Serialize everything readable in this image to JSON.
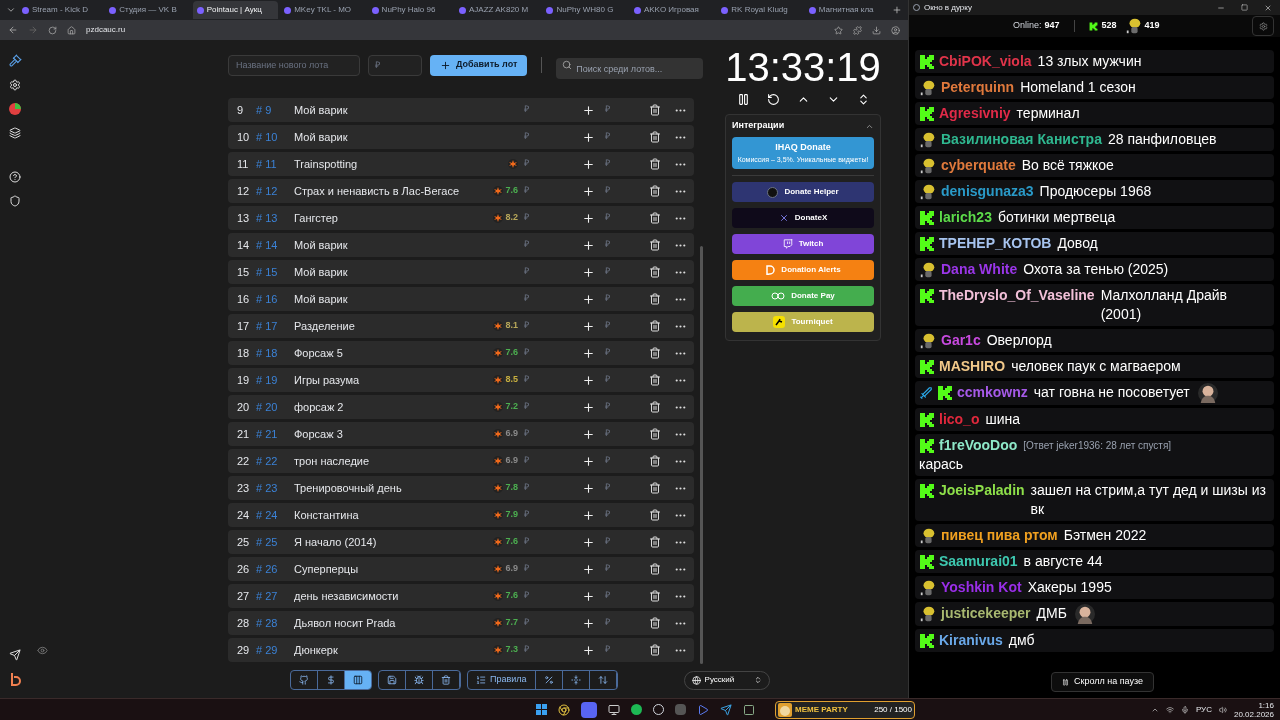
{
  "browser": {
    "tabs": [
      {
        "title": "Stream - Kick D",
        "selected": false
      },
      {
        "title": "Студия — VK В",
        "selected": false
      },
      {
        "title": "Pointauc | Аукц",
        "selected": true
      },
      {
        "title": "MKey TKL - MO",
        "selected": false
      },
      {
        "title": "NuPhy Halo 96",
        "selected": false
      },
      {
        "title": "AJAZZ AK820 M",
        "selected": false
      },
      {
        "title": "NuPhy WH80 G",
        "selected": false
      },
      {
        "title": "AKKO Игровая",
        "selected": false
      },
      {
        "title": "RK Royal Kludg",
        "selected": false
      },
      {
        "title": "Магнитная кла",
        "selected": false
      }
    ],
    "address": "pzdcauc.ru"
  },
  "toolbar": {
    "lot_name": {
      "placeholder": "Название нового лота"
    },
    "amount": {
      "placeholder": "₽"
    },
    "add_button": "Добавить лот",
    "search": {
      "placeholder": "Поиск среди лотов..."
    }
  },
  "lots": [
    {
      "index": "9",
      "id": "# 9",
      "name": "Мой варик",
      "badge": false,
      "currency": "₽",
      "currency2": "₽"
    },
    {
      "index": "10",
      "id": "# 10",
      "name": "Мой варик",
      "badge": false,
      "currency": "₽",
      "currency2": "₽"
    },
    {
      "index": "11",
      "id": "# 11",
      "name": "Trainspotting",
      "badge": true,
      "currency": "₽",
      "currency2": "₽"
    },
    {
      "index": "12",
      "id": "# 12",
      "name": "Страх и ненависть в Лас-Вегасе",
      "badge": true,
      "rating": "7.6",
      "color": "#4caf50",
      "currency": "₽",
      "currency2": "₽"
    },
    {
      "index": "13",
      "id": "# 13",
      "name": "Гангстер",
      "badge": true,
      "rating": "8.2",
      "color": "#b8a85a",
      "currency": "₽",
      "currency2": "₽"
    },
    {
      "index": "14",
      "id": "# 14",
      "name": "Мой варик",
      "badge": false,
      "currency": "₽",
      "currency2": "₽"
    },
    {
      "index": "15",
      "id": "# 15",
      "name": "Мой варик",
      "badge": false,
      "currency": "₽",
      "currency2": "₽"
    },
    {
      "index": "16",
      "id": "# 16",
      "name": "Мой варик",
      "badge": false,
      "currency": "₽",
      "currency2": "₽"
    },
    {
      "index": "17",
      "id": "# 17",
      "name": "Разделение",
      "badge": true,
      "rating": "8.1",
      "color": "#b8a85a",
      "currency": "₽",
      "currency2": "₽"
    },
    {
      "index": "18",
      "id": "# 18",
      "name": "Форсаж 5",
      "badge": true,
      "rating": "7.6",
      "color": "#4caf50",
      "currency": "₽",
      "currency2": "₽"
    },
    {
      "index": "19",
      "id": "# 19",
      "name": "Игры разума",
      "badge": true,
      "rating": "8.5",
      "color": "#c8b040",
      "currency": "₽",
      "currency2": "₽"
    },
    {
      "index": "20",
      "id": "# 20",
      "name": "форсаж 2",
      "badge": true,
      "rating": "7.2",
      "color": "#4caf50",
      "currency": "₽",
      "currency2": "₽"
    },
    {
      "index": "21",
      "id": "# 21",
      "name": "Форсаж 3",
      "badge": true,
      "rating": "6.9",
      "color": "#8a8a8a",
      "currency": "₽",
      "currency2": "₽"
    },
    {
      "index": "22",
      "id": "# 22",
      "name": "трон наследие",
      "badge": true,
      "rating": "6.9",
      "color": "#8a8a8a",
      "currency": "₽",
      "currency2": "₽"
    },
    {
      "index": "23",
      "id": "# 23",
      "name": "Тренировочный день",
      "badge": true,
      "rating": "7.8",
      "color": "#4caf50",
      "currency": "₽",
      "currency2": "₽"
    },
    {
      "index": "24",
      "id": "# 24",
      "name": "Константина",
      "badge": true,
      "rating": "7.9",
      "color": "#4caf50",
      "currency": "₽",
      "currency2": "₽"
    },
    {
      "index": "25",
      "id": "# 25",
      "name": "Я начало (2014)",
      "badge": true,
      "rating": "7.6",
      "color": "#4caf50",
      "currency": "₽",
      "currency2": "₽"
    },
    {
      "index": "26",
      "id": "# 26",
      "name": "Суперперцы",
      "badge": true,
      "rating": "6.9",
      "color": "#8a8a8a",
      "currency": "₽",
      "currency2": "₽"
    },
    {
      "index": "27",
      "id": "# 27",
      "name": "день независимости",
      "badge": true,
      "rating": "7.6",
      "color": "#4caf50",
      "currency": "₽",
      "currency2": "₽"
    },
    {
      "index": "28",
      "id": "# 28",
      "name": "Дьявол носит Prada",
      "badge": true,
      "rating": "7.7",
      "color": "#4caf50",
      "currency": "₽",
      "currency2": "₽"
    },
    {
      "index": "29",
      "id": "# 29",
      "name": "Дюнкерк",
      "badge": true,
      "rating": "7.3",
      "color": "#4caf50",
      "currency": "₽",
      "currency2": "₽"
    }
  ],
  "timer": {
    "time": "13:33:19"
  },
  "integrations": {
    "title": "Интеграции",
    "featured": {
      "name": "IHAQ Donate",
      "subtitle": "Комиссия – 3,5%. Уникальные виджеты!",
      "color": "#3396d3"
    },
    "buttons": [
      {
        "label": "Donate Helper",
        "color": "#2e3572"
      },
      {
        "label": "DonateX",
        "color": "#0f0a1a"
      },
      {
        "label": "Twitch",
        "color": "#8045d8"
      },
      {
        "label": "Donation Alerts",
        "color": "#f58112"
      },
      {
        "label": "Donate Pay",
        "color": "#44ad4e"
      },
      {
        "label": "Tourniquet",
        "color": "#bcb44c"
      }
    ]
  },
  "bottom_tools": [
    [
      {
        "selected": false
      },
      {
        "selected": false
      },
      {
        "selected": true
      }
    ],
    [
      {
        "selected": false
      },
      {
        "selected": false
      },
      {
        "selected": false
      }
    ],
    [
      {
        "label": "Правила",
        "selected": false
      },
      {
        "selected": false
      },
      {
        "selected": false
      },
      {
        "selected": false
      }
    ]
  ],
  "language": "Русский",
  "chat": {
    "title": "Окно в дурку",
    "online_label": "Online:",
    "online": "947",
    "kick_count": "528",
    "other_count": "419",
    "messages": [
      {
        "kind": "kick",
        "user": "CbiPOK_viola",
        "color": "#e0344a",
        "text": "13 злых мужчин",
        "emote": false,
        "mod": false
      },
      {
        "kind": "avatar",
        "user": "Peterquinn",
        "color": "#e0793c",
        "text": "Homeland 1 сезон",
        "emote": false,
        "mod": false
      },
      {
        "kind": "kick",
        "user": "Agresivniy",
        "color": "#e02a48",
        "text": "терминал",
        "emote": false,
        "mod": false
      },
      {
        "kind": "avatar",
        "user": "Вазилиновая Канистра",
        "color": "#2fb890",
        "text": "28 панфиловцев",
        "emote": false,
        "mod": false
      },
      {
        "kind": "avatar",
        "user": "cyberquate",
        "color": "#e07a3c",
        "text": "Во всё тяжкое",
        "emote": false,
        "mod": false
      },
      {
        "kind": "avatar",
        "user": "denisgunaza3",
        "color": "#2a9ac8",
        "text": "Продюсеры 1968",
        "emote": false,
        "mod": false
      },
      {
        "kind": "kick",
        "user": "larich23",
        "color": "#5ddc4a",
        "text": "ботинки мертвеца",
        "emote": false,
        "mod": false
      },
      {
        "kind": "kick",
        "user": "ТРЕНЕР_КОТОВ",
        "color": "#a7c4ef",
        "text": "Довод",
        "emote": false,
        "mod": false
      },
      {
        "kind": "avatar",
        "user": "Dana White",
        "color": "#9a36e8",
        "text": "Охота за тенью (2025)",
        "emote": false,
        "mod": false
      },
      {
        "kind": "kick",
        "user": "TheDryslo_Of_Vaseline",
        "color": "#f2c0d8",
        "text": "Малхолланд Драйв (2001)",
        "emote": false,
        "mod": false
      },
      {
        "kind": "avatar",
        "user": "Gar1c",
        "color": "#c84ae0",
        "text": "Оверлорд",
        "emote": false,
        "mod": false
      },
      {
        "kind": "kick",
        "user": "MASHIRO",
        "color": "#f2c98a",
        "text": "человек паук с магваером",
        "emote": false,
        "mod": false
      },
      {
        "kind": "kick",
        "user": "ccmkownz",
        "color": "#a65ae8",
        "text": "чат говна не посоветует",
        "emote": true,
        "mod": true
      },
      {
        "kind": "kick",
        "user": "lico_o",
        "color": "#e0283c",
        "text": "шина",
        "emote": false,
        "mod": false
      },
      {
        "kind": "kick",
        "user": "f1reVooDoo",
        "color": "#8ee8c8",
        "reply": "[Ответ jeker1936: 28 лет спустя]",
        "text": "карась",
        "emote": false,
        "mod": false
      },
      {
        "kind": "kick",
        "user": "JoeisPaladin",
        "color": "#8ee04a",
        "text": "зашел на стрим,а тут дед и шизы из вк",
        "emote": false,
        "mod": false
      },
      {
        "kind": "avatar",
        "user": "пивец пива ртом",
        "color": "#f0a020",
        "text": "Бэтмен 2022",
        "emote": false,
        "mod": false
      },
      {
        "kind": "kick",
        "user": "Saamurai01",
        "color": "#3ec8b0",
        "text": "в августе 44",
        "emote": false,
        "mod": false
      },
      {
        "kind": "avatar",
        "user": "Yoshkin Kot",
        "color": "#9a2ee8",
        "text": "Хакеры 1995",
        "emote": false,
        "mod": false
      },
      {
        "kind": "avatar",
        "user": "justicekeeper",
        "color": "#a8b870",
        "text": "ДМБ",
        "emote": true,
        "mod": false
      },
      {
        "kind": "kick",
        "user": "Kiranivus",
        "color": "#6aa8e8",
        "text": "дмб",
        "emote": false,
        "mod": false
      }
    ],
    "paused_notice": "Скролл на паузе"
  },
  "taskbar": {
    "meme_title": "MEME PARTY",
    "meme_progress": "250 / 1500",
    "language": "РУС",
    "time": "1:16",
    "date": "20.02.2026"
  }
}
